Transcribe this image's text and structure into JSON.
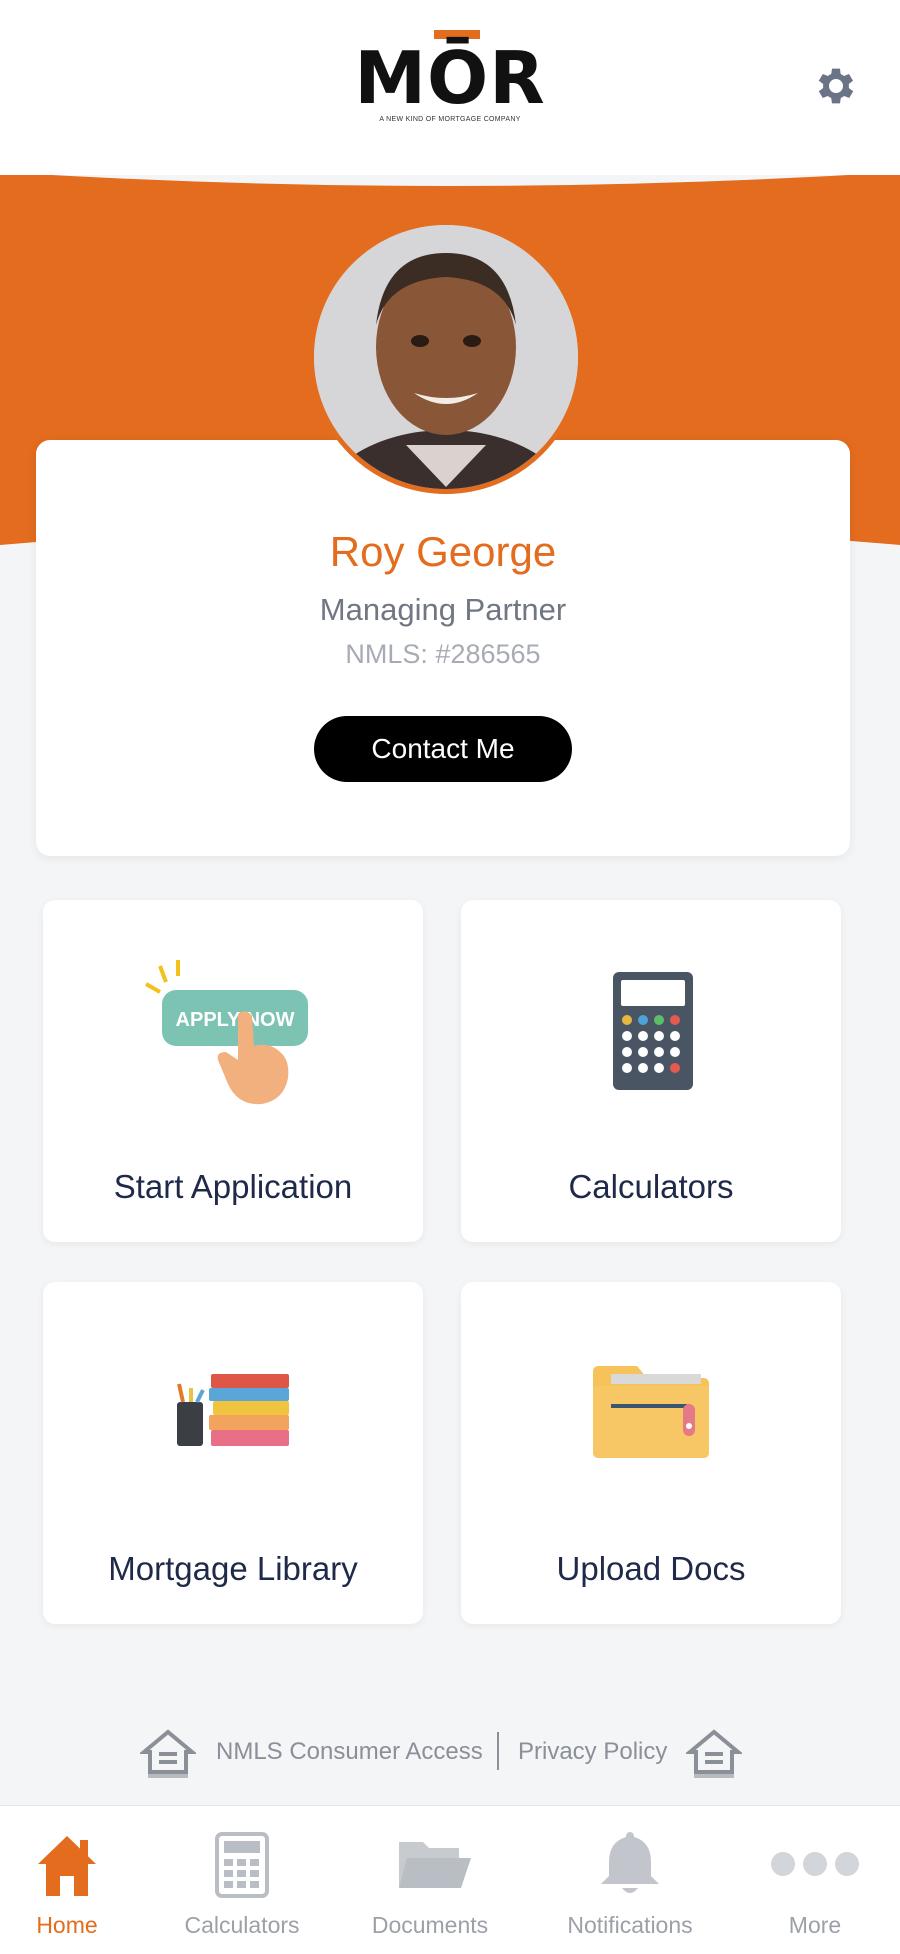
{
  "header": {
    "logo_text": "MŌR",
    "logo_tagline": "A NEW KIND OF MORTGAGE COMPANY",
    "settings_icon": "gear-icon"
  },
  "profile": {
    "name": "Roy George",
    "title": "Managing Partner",
    "nmls": "NMLS: #286565",
    "contact_label": "Contact Me"
  },
  "tiles": [
    {
      "label": "Start Application",
      "icon": "apply-now-icon",
      "icon_text": "APPLY NOW"
    },
    {
      "label": "Calculators",
      "icon": "calculator-icon"
    },
    {
      "label": "Mortgage Library",
      "icon": "books-icon"
    },
    {
      "label": "Upload Docs",
      "icon": "folder-icon"
    }
  ],
  "footer": {
    "nmls_link": "NMLS Consumer Access",
    "privacy_link": "Privacy Policy",
    "equal_housing_icon": "equal-housing-icon"
  },
  "tabbar": {
    "items": [
      {
        "label": "Home",
        "icon": "home-icon",
        "active": true
      },
      {
        "label": "Calculators",
        "icon": "calculator-icon",
        "active": false
      },
      {
        "label": "Documents",
        "icon": "folder-icon",
        "active": false
      },
      {
        "label": "Notifications",
        "icon": "bell-icon",
        "active": false
      },
      {
        "label": "More",
        "icon": "more-icon",
        "active": false
      }
    ]
  },
  "colors": {
    "brand_orange": "#e36c1e",
    "background": "#f4f5f7",
    "tile_text": "#1f2a4a",
    "muted_text": "#707682"
  }
}
